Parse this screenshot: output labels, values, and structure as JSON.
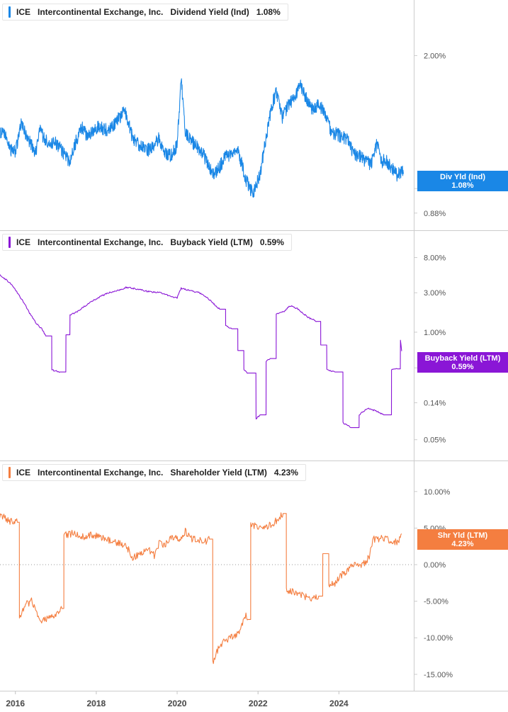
{
  "colors": {
    "dividend": "#1a87e6",
    "buyback": "#8a16d6",
    "shareholder": "#f47e40",
    "axis": "#cccccc",
    "text": "#555555"
  },
  "panels": [
    {
      "ticker": "ICE",
      "company": "Intercontinental Exchange, Inc.",
      "metric": "Dividend Yield (Ind)",
      "value": "1.08%",
      "flag_line1": "Div Yld (Ind)",
      "flag_line2": "1.08%"
    },
    {
      "ticker": "ICE",
      "company": "Intercontinental Exchange, Inc.",
      "metric": "Buyback Yield (LTM)",
      "value": "0.59%",
      "flag_line1": "Buyback Yield (LTM)",
      "flag_line2": "0.59%"
    },
    {
      "ticker": "ICE",
      "company": "Intercontinental Exchange, Inc.",
      "metric": "Shareholder Yield (LTM)",
      "value": "4.23%",
      "flag_line1": "Shr Yld (LTM)",
      "flag_line2": "4.23%"
    }
  ],
  "chart_data": [
    {
      "type": "line",
      "scale": "log",
      "series": [
        {
          "name": "Dividend Yield (Ind)",
          "x": [
            2015.6,
            2015.8,
            2015.9,
            2016.0,
            2016.15,
            2016.3,
            2016.5,
            2016.6,
            2016.75,
            2017.0,
            2017.2,
            2017.35,
            2017.5,
            2017.65,
            2017.8,
            2017.9,
            2018.1,
            2018.3,
            2018.5,
            2018.7,
            2018.9,
            2019.1,
            2019.25,
            2019.4,
            2019.55,
            2019.7,
            2019.85,
            2020.0,
            2020.1,
            2020.2,
            2020.3,
            2020.45,
            2020.6,
            2020.75,
            2020.9,
            2021.05,
            2021.2,
            2021.35,
            2021.5,
            2021.7,
            2021.8,
            2021.9,
            2022.05,
            2022.2,
            2022.35,
            2022.45,
            2022.6,
            2022.75,
            2022.9,
            2023.05,
            2023.2,
            2023.35,
            2023.5,
            2023.65,
            2023.8,
            2024.0,
            2024.2,
            2024.35,
            2024.5,
            2024.65,
            2024.8,
            2024.95,
            2025.05,
            2025.15,
            2025.3,
            2025.45,
            2025.55,
            2025.6
          ],
          "values": [
            1.35,
            1.3,
            1.22,
            1.21,
            1.4,
            1.3,
            1.2,
            1.36,
            1.28,
            1.27,
            1.2,
            1.15,
            1.28,
            1.38,
            1.3,
            1.36,
            1.38,
            1.35,
            1.42,
            1.5,
            1.3,
            1.25,
            1.22,
            1.24,
            1.3,
            1.2,
            1.19,
            1.25,
            1.75,
            1.35,
            1.3,
            1.25,
            1.22,
            1.14,
            1.08,
            1.12,
            1.18,
            1.2,
            1.22,
            1.05,
            1.0,
            0.98,
            1.08,
            1.3,
            1.55,
            1.65,
            1.45,
            1.55,
            1.6,
            1.72,
            1.6,
            1.5,
            1.55,
            1.48,
            1.35,
            1.32,
            1.3,
            1.2,
            1.19,
            1.15,
            1.14,
            1.27,
            1.15,
            1.16,
            1.12,
            1.07,
            1.1,
            1.08
          ]
        }
      ],
      "ylim": [
        0.86,
        2.5
      ],
      "xlim": [
        2015.62,
        2025.85
      ],
      "yticks": [
        "2.00%",
        "1.00%",
        "0.88%"
      ],
      "xticks": [
        "2016",
        "2018",
        "2020",
        "2022",
        "2024"
      ]
    },
    {
      "type": "line",
      "scale": "log",
      "series": [
        {
          "name": "Buyback Yield (LTM)",
          "x": [
            2015.6,
            2015.85,
            2016.05,
            2016.2,
            2016.35,
            2016.5,
            2016.65,
            2016.75,
            2016.9,
            2017.1,
            2017.25,
            2017.35,
            2017.55,
            2017.8,
            2018.1,
            2018.3,
            2018.55,
            2018.75,
            2019.05,
            2019.3,
            2019.6,
            2019.85,
            2020.0,
            2020.1,
            2020.3,
            2020.55,
            2020.75,
            2020.9,
            2021.05,
            2021.2,
            2021.35,
            2021.5,
            2021.65,
            2021.75,
            2021.95,
            2022.05,
            2022.2,
            2022.3,
            2022.45,
            2022.65,
            2022.8,
            2023.0,
            2023.1,
            2023.25,
            2023.45,
            2023.55,
            2023.7,
            2023.9,
            2024.1,
            2024.3,
            2024.5,
            2024.7,
            2024.95,
            2025.1,
            2025.3,
            2025.45,
            2025.52,
            2025.55
          ],
          "values": [
            5.0,
            4.0,
            3.0,
            2.3,
            1.7,
            1.3,
            1.1,
            0.9,
            0.35,
            0.33,
            0.93,
            1.6,
            1.8,
            2.2,
            2.7,
            3.0,
            3.2,
            3.5,
            3.3,
            3.1,
            3.0,
            2.7,
            2.6,
            3.4,
            3.2,
            3.0,
            2.6,
            2.2,
            1.9,
            1.2,
            1.1,
            0.6,
            0.35,
            0.32,
            0.09,
            0.1,
            0.45,
            0.48,
            1.65,
            1.8,
            2.1,
            1.9,
            1.7,
            1.5,
            1.35,
            0.7,
            0.35,
            0.33,
            0.08,
            0.07,
            0.1,
            0.12,
            0.11,
            0.1,
            0.35,
            0.36,
            0.8,
            0.59
          ]
        }
      ],
      "ylim": [
        0.04,
        12
      ],
      "xlim": [
        2015.62,
        2025.85
      ],
      "yticks": [
        "8.00%",
        "3.00%",
        "1.00%",
        "0.37%",
        "0.14%",
        "0.05%"
      ]
    },
    {
      "type": "line",
      "scale": "linear",
      "series": [
        {
          "name": "Shareholder Yield (LTM)",
          "x": [
            2015.6,
            2015.85,
            2016.05,
            2016.1,
            2016.25,
            2016.4,
            2016.6,
            2016.75,
            2016.85,
            2016.95,
            2017.15,
            2017.2,
            2017.45,
            2017.65,
            2017.85,
            2018.0,
            2018.2,
            2018.5,
            2018.75,
            2018.9,
            2019.1,
            2019.3,
            2019.45,
            2019.55,
            2019.7,
            2019.9,
            2020.05,
            2020.2,
            2020.35,
            2020.55,
            2020.75,
            2020.8,
            2020.88,
            2021.05,
            2021.3,
            2021.5,
            2021.7,
            2021.75,
            2021.82,
            2022.1,
            2022.25,
            2022.4,
            2022.55,
            2022.62,
            2022.7,
            2023.0,
            2023.2,
            2023.35,
            2023.5,
            2023.6,
            2023.75,
            2023.9,
            2024.05,
            2024.2,
            2024.35,
            2024.6,
            2024.75,
            2024.85,
            2025.1,
            2025.3,
            2025.45,
            2025.55
          ],
          "values": [
            7.0,
            6.0,
            5.8,
            -7.5,
            -5.5,
            -5.0,
            -7.8,
            -7.5,
            -7.0,
            -7.0,
            -6.0,
            4.0,
            4.3,
            3.8,
            4.1,
            4.0,
            3.5,
            3.0,
            2.5,
            1.0,
            1.5,
            2.0,
            1.2,
            3.0,
            2.7,
            3.8,
            3.3,
            4.6,
            3.5,
            3.4,
            3.2,
            3.5,
            -13.5,
            -11.0,
            -10.0,
            -9.5,
            -7.0,
            -7.5,
            5.5,
            5.0,
            5.3,
            5.8,
            6.5,
            7.0,
            -3.5,
            -4.0,
            -4.5,
            -4.7,
            -4.3,
            1.5,
            -3.0,
            -2.5,
            -1.5,
            -1.0,
            0.0,
            0.0,
            1.0,
            3.5,
            3.6,
            3.2,
            3.0,
            4.23
          ]
        }
      ],
      "ylim": [
        -15.5,
        12.5
      ],
      "xlim": [
        2015.62,
        2025.85
      ],
      "yticks": [
        "10.00%",
        "5.00%",
        "0.00%",
        "-5.00%",
        "-10.00%",
        "-15.00%"
      ],
      "zero_line": "dotted"
    }
  ]
}
